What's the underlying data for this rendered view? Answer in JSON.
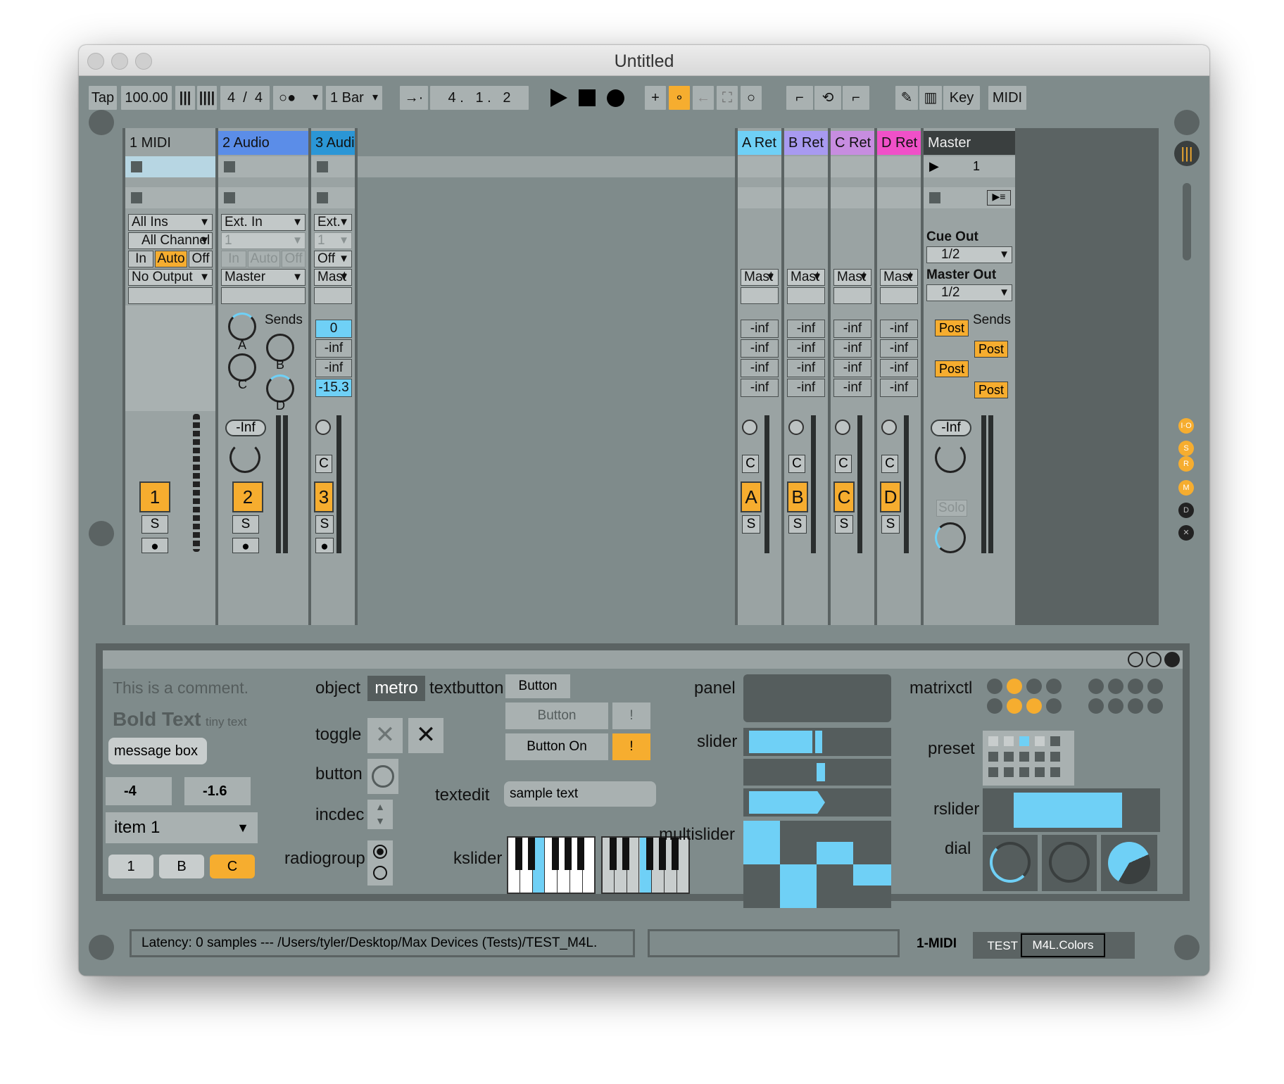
{
  "window": {
    "title": "Untitled"
  },
  "toolbar": {
    "tap": "Tap",
    "tempo": "100.00",
    "sig_num": "4",
    "sig_slash": "/",
    "sig_den": "4",
    "quant": "1 Bar",
    "pos1": "4 .",
    "pos2": "1 .",
    "pos3": "2",
    "key": "Key",
    "midi": "MIDI"
  },
  "tracks": [
    {
      "name": "1 MIDI",
      "color": "#9aa3a3",
      "input": "All Ins",
      "channel": "All Channel",
      "mon_in": "In",
      "mon_auto": "Auto",
      "mon_off": "Off",
      "output": "No Output",
      "num": "1",
      "solo": "S"
    },
    {
      "name": "2 Audio",
      "color": "#5b8de8",
      "input": "Ext. In",
      "channel": "1",
      "mon_in": "In",
      "mon_auto": "Auto",
      "mon_off": "Off",
      "output": "Master",
      "vol": "-Inf",
      "num": "2",
      "solo": "S"
    },
    {
      "name": "3 Audi",
      "color": "#2b96d6",
      "input": "Ext.",
      "channel": "1",
      "mon": "Off",
      "output": "Mast",
      "num": "3",
      "solo": "S",
      "c": "C",
      "v0": "0",
      "v1": "-inf",
      "v2": "-inf",
      "v3": "-15.3"
    }
  ],
  "sends": {
    "title": "Sends",
    "a": "A",
    "b": "B",
    "c": "C",
    "d": "D"
  },
  "returns": [
    {
      "name": "A Ret",
      "color": "#6fd0f6",
      "out": "Mast",
      "letter": "A",
      "c": "C",
      "solo": "S"
    },
    {
      "name": "B Ret",
      "color": "#a89af0",
      "out": "Mast",
      "letter": "B",
      "c": "C",
      "solo": "S"
    },
    {
      "name": "C Ret",
      "color": "#c78de0",
      "out": "Mast",
      "letter": "C",
      "c": "C",
      "solo": "S"
    },
    {
      "name": "D Ret",
      "color": "#f050c8",
      "out": "Mast",
      "letter": "D",
      "c": "C",
      "solo": "S"
    }
  ],
  "inf": "-inf",
  "master": {
    "name": "Master",
    "scene": "1",
    "cue_out": "Cue Out",
    "cue_val": "1/2",
    "master_out": "Master Out",
    "master_val": "1/2",
    "sends": "Sends",
    "post": "Post",
    "vol": "-Inf",
    "solo": "Solo"
  },
  "side": {
    "io": "I·O",
    "s": "S",
    "r": "R",
    "m": "M",
    "d": "D",
    "x": "✕"
  },
  "device": {
    "comment": "This is a comment.",
    "bold": "Bold Text",
    "tiny": "tiny text",
    "message": "message box",
    "num1": "-4",
    "num2": "-1.6",
    "umenu": "item 1",
    "tab1": "1",
    "tab2": "B",
    "tab3": "C",
    "object": "object",
    "metro": "metro",
    "toggle": "toggle",
    "button": "button",
    "incdec": "incdec",
    "radiogroup": "radiogroup",
    "textbutton": "textbutton",
    "tb1": "Button",
    "tb2": "Button",
    "tb3": "Button On",
    "excl": "!",
    "textedit": "textedit",
    "textedit_val": "sample text",
    "kslider": "kslider",
    "panel": "panel",
    "slider": "slider",
    "multislider": "multislider",
    "matrixctl": "matrixctl",
    "preset": "preset",
    "rslider": "rslider",
    "dial": "dial"
  },
  "status": {
    "latency": "Latency: 0 samples --- /Users/tyler/Desktop/Max Devices (Tests)/TEST_M4L.",
    "track": "1-MIDI",
    "chain1": "TEST",
    "chain2": "M4L.Colors"
  },
  "colors": {
    "orange": "#f6ad2f",
    "blue": "#6fd0f6"
  }
}
